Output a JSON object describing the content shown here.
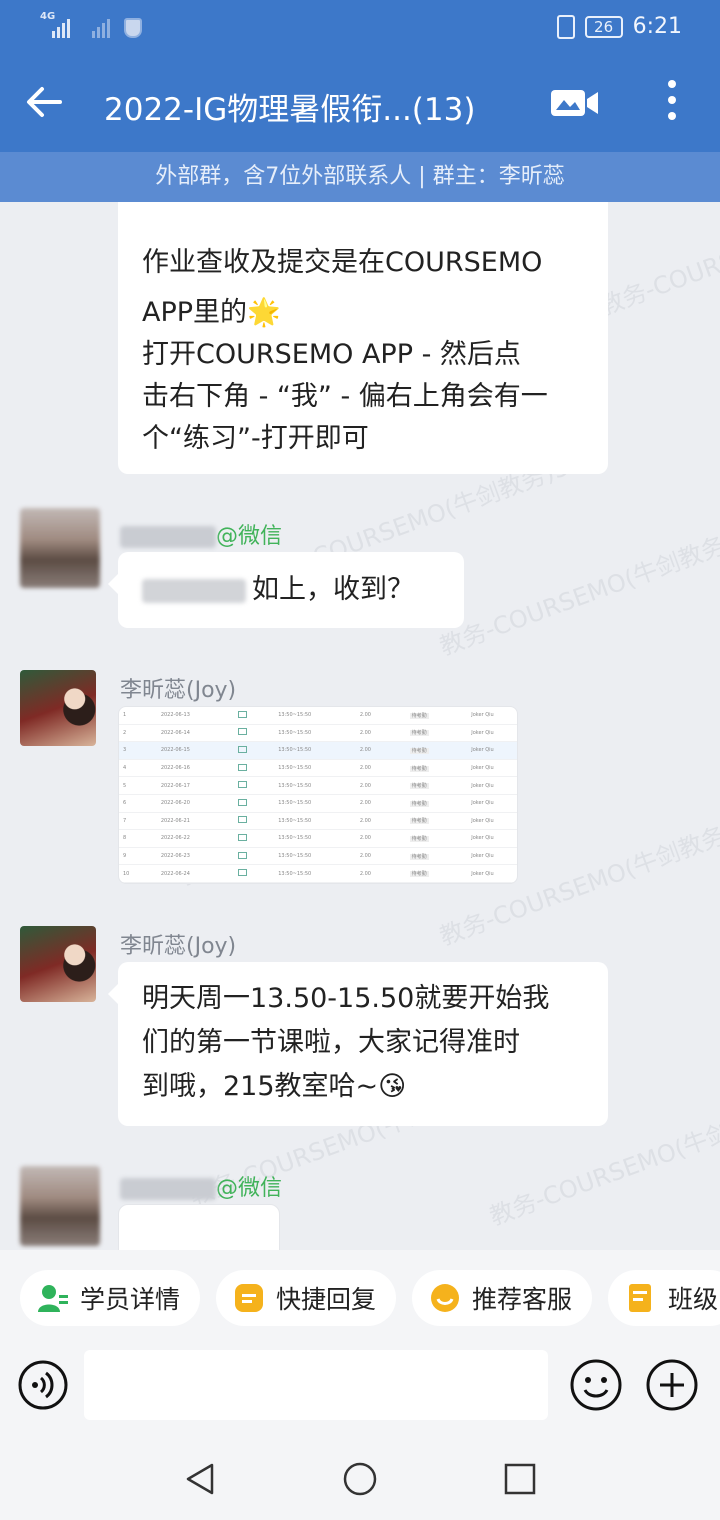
{
  "status": {
    "network_label": "4G",
    "battery": "26",
    "time": "6:21"
  },
  "header": {
    "title": "2022-IG物理暑假衔...(13)",
    "subtitle": "外部群，含7位外部联系人 | 群主：李昕蕊"
  },
  "watermark": "教务-COURSEMO(牛剑教务)3",
  "messages": {
    "m1": {
      "lines": [
        "作业查收及提交是在COURSEMO",
        "APP里的🌟",
        "打开COURSEMO APP - 然后点",
        "击右下角 - “我” - 偏右上角会有一",
        "个“练习”-打开即可"
      ]
    },
    "m2": {
      "sender_suffix": "@微信",
      "text": "如上，收到？"
    },
    "m3": {
      "sender": "李昕蕊(Joy)",
      "table_rows": [
        {
          "n": "1",
          "date": "2022-06-13",
          "time": "13:50~15:50",
          "hours": "2.00",
          "status": "待考勤",
          "teacher": "Joker Qiu"
        },
        {
          "n": "2",
          "date": "2022-06-14",
          "time": "13:50~15:50",
          "hours": "2.00",
          "status": "待考勤",
          "teacher": "Joker Qiu"
        },
        {
          "n": "3",
          "date": "2022-06-15",
          "time": "13:50~15:50",
          "hours": "2.00",
          "status": "待考勤",
          "teacher": "Joker Qiu"
        },
        {
          "n": "4",
          "date": "2022-06-16",
          "time": "13:50~15:50",
          "hours": "2.00",
          "status": "待考勤",
          "teacher": "Joker Qiu"
        },
        {
          "n": "5",
          "date": "2022-06-17",
          "time": "13:50~15:50",
          "hours": "2.00",
          "status": "待考勤",
          "teacher": "Joker Qiu"
        },
        {
          "n": "6",
          "date": "2022-06-20",
          "time": "13:50~15:50",
          "hours": "2.00",
          "status": "待考勤",
          "teacher": "Joker Qiu"
        },
        {
          "n": "7",
          "date": "2022-06-21",
          "time": "13:50~15:50",
          "hours": "2.00",
          "status": "待考勤",
          "teacher": "Joker Qiu"
        },
        {
          "n": "8",
          "date": "2022-06-22",
          "time": "13:50~15:50",
          "hours": "2.00",
          "status": "待考勤",
          "teacher": "Joker Qiu"
        },
        {
          "n": "9",
          "date": "2022-06-23",
          "time": "13:50~15:50",
          "hours": "2.00",
          "status": "待考勤",
          "teacher": "Joker Qiu"
        },
        {
          "n": "10",
          "date": "2022-06-24",
          "time": "13:50~15:50",
          "hours": "2.00",
          "status": "待考勤",
          "teacher": "Joker Qiu"
        }
      ]
    },
    "m4": {
      "sender": "李昕蕊(Joy)",
      "lines": [
        "明天周一13.50-15.50就要开始我",
        "们的第一节课啦，大家记得准时",
        "到哦，215教室哈~😘"
      ]
    },
    "m5": {
      "sender_suffix": "@微信"
    }
  },
  "quick_actions": [
    {
      "label": "学员详情",
      "icon": "student-info-icon",
      "color": "#2fb35b"
    },
    {
      "label": "快捷回复",
      "icon": "quick-reply-icon",
      "color": "#f5b21c"
    },
    {
      "label": "推荐客服",
      "icon": "recommend-service-icon",
      "color": "#f5b21c"
    },
    {
      "label": "班级",
      "icon": "class-icon",
      "color": "#f5b21c"
    }
  ],
  "colors": {
    "header": "#3d78c9",
    "subbar": "#5b8bd2",
    "wechat_green": "#41b35a"
  }
}
